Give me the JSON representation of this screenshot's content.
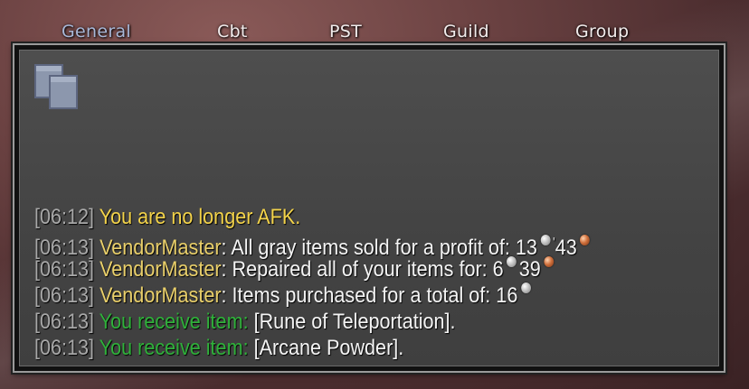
{
  "tabs": [
    {
      "label": "General",
      "active": true
    },
    {
      "label": "Cbt",
      "active": false
    },
    {
      "label": "PST",
      "active": false
    },
    {
      "label": "Guild",
      "active": false
    },
    {
      "label": "Group",
      "active": false
    }
  ],
  "toolbar": {
    "copy_icon": "copy-icon"
  },
  "chat": [
    {
      "time": "[06:12]",
      "text": "You are no longer AFK."
    },
    {
      "time": "[06:13]",
      "speaker": "VendorMaster",
      "text": "All gray items sold for a profit of: 13",
      "silver": "",
      "copper_amount": "43"
    },
    {
      "time": "[06:13]",
      "speaker": "VendorMaster",
      "text": "Repaired all of your items for: 6",
      "copper_amount": "39"
    },
    {
      "time": "[06:13]",
      "speaker": "VendorMaster",
      "text": "Items purchased for a total of: 16"
    },
    {
      "time": "[06:13]",
      "prefix": "You receive item:",
      "item": "[Rune of Teleportation]",
      "end": "."
    },
    {
      "time": "[06:13]",
      "prefix": "You receive item:",
      "item": "[Arcane Powder]",
      "end": "."
    }
  ],
  "colors": {
    "timestamp": "#a8a8a8",
    "system_yellow": "#f3d34a",
    "vendor": "#e9cf6a",
    "loot_green": "#2fb13a",
    "active_tab": "#a9b8d8"
  }
}
